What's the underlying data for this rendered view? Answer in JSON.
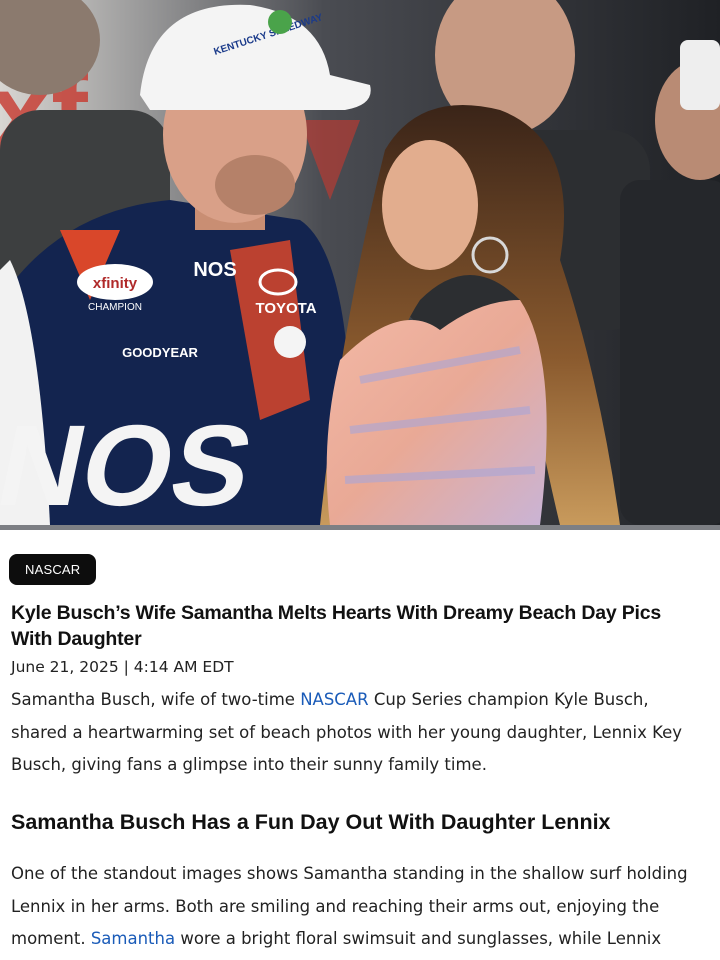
{
  "hero": {
    "cap_text": "KENTUCKY SPEEDWAY",
    "suit_sponsor_1": "xfinity",
    "suit_sponsor_2": "NOS",
    "suit_sponsor_3": "TOYOTA",
    "suit_sponsor_4": "GOODYEAR",
    "suit_champion": "CHAMPION"
  },
  "article": {
    "category": "NASCAR",
    "headline": "Kyle Busch’s Wife Samantha Melts Hearts With Dreamy Beach Day Pics With Daughter",
    "dateline": "June 21, 2025 | 4:14 AM EDT",
    "intro": {
      "before": "Samantha Busch, wife of two-time ",
      "link": "NASCAR",
      "after": " Cup Series champion Kyle Busch, shared a heartwarming set of beach photos with her young daughter, Lennix Key Busch, giving fans a glimpse into their sunny family time."
    },
    "subhead": "Samantha Busch Has a Fun Day Out With Daughter Lennix",
    "body": {
      "before": "One of the standout images shows Samantha standing in the shallow surf holding Lennix in her arms. Both are smiling and reaching their arms out, enjoying the moment. ",
      "link": "Samantha",
      "after": " wore a bright floral swimsuit and sunglasses, while Lennix"
    }
  },
  "colors": {
    "badge_bg": "#0d0d0d",
    "link": "#1a5bb8",
    "text": "#222222"
  }
}
